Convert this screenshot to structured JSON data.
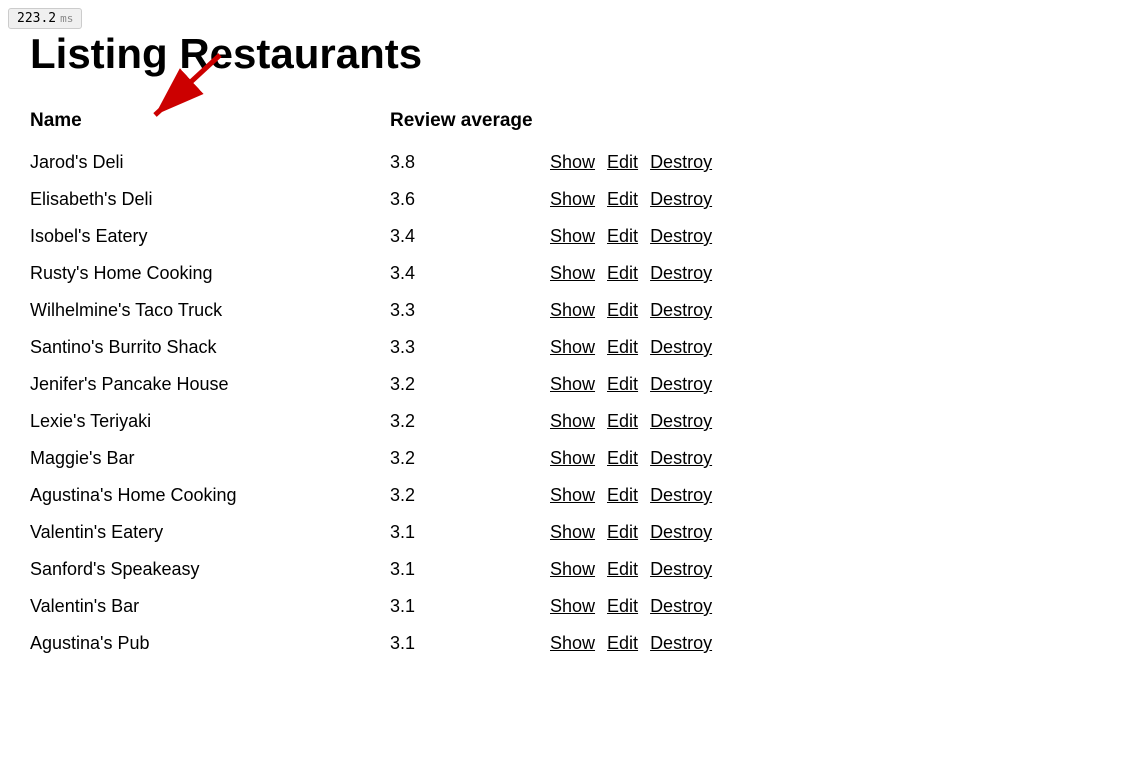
{
  "perf": {
    "value": "223.2",
    "unit": "ms"
  },
  "page": {
    "title": "Listing Restaurants"
  },
  "table": {
    "columns": [
      {
        "key": "name",
        "label": "Name"
      },
      {
        "key": "review_average",
        "label": "Review average"
      }
    ],
    "rows": [
      {
        "name": "Jarod's Deli",
        "review_average": "3.8"
      },
      {
        "name": "Elisabeth's Deli",
        "review_average": "3.6"
      },
      {
        "name": "Isobel's Eatery",
        "review_average": "3.4"
      },
      {
        "name": "Rusty's Home Cooking",
        "review_average": "3.4"
      },
      {
        "name": "Wilhelmine's Taco Truck",
        "review_average": "3.3"
      },
      {
        "name": "Santino's Burrito Shack",
        "review_average": "3.3"
      },
      {
        "name": "Jenifer's Pancake House",
        "review_average": "3.2"
      },
      {
        "name": "Lexie's Teriyaki",
        "review_average": "3.2"
      },
      {
        "name": "Maggie's Bar",
        "review_average": "3.2"
      },
      {
        "name": "Agustina's Home Cooking",
        "review_average": "3.2"
      },
      {
        "name": "Valentin's Eatery",
        "review_average": "3.1"
      },
      {
        "name": "Sanford's Speakeasy",
        "review_average": "3.1"
      },
      {
        "name": "Valentin's Bar",
        "review_average": "3.1"
      },
      {
        "name": "Agustina's Pub",
        "review_average": "3.1"
      }
    ],
    "actions": {
      "show": "Show",
      "edit": "Edit",
      "destroy": "Destroy"
    }
  }
}
